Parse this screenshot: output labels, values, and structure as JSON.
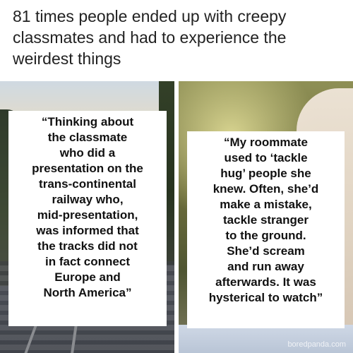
{
  "headline": "81 times people ended up with creepy classmates and had to experience the weirdest things",
  "panels": [
    {
      "quote": "“Thinking about\nthe classmate\nwho did a\npresentation on the\ntrans-continental\nrailway who,\nmid-presentation,\nwas informed that\nthe tracks did not\nin fact connect\nEurope and\nNorth America”",
      "image": "railway-photo"
    },
    {
      "quote": "“My roommate\nused to ‘tackle\nhug’ people she\nknew. Often, she’d\nmake a mistake,\ntackle stranger\nto the ground.\nShe’d scream\nand run away\nafterwards. It was\nhysterical to watch”",
      "image": "person-photo",
      "watermark": "boredpanda.com"
    }
  ]
}
